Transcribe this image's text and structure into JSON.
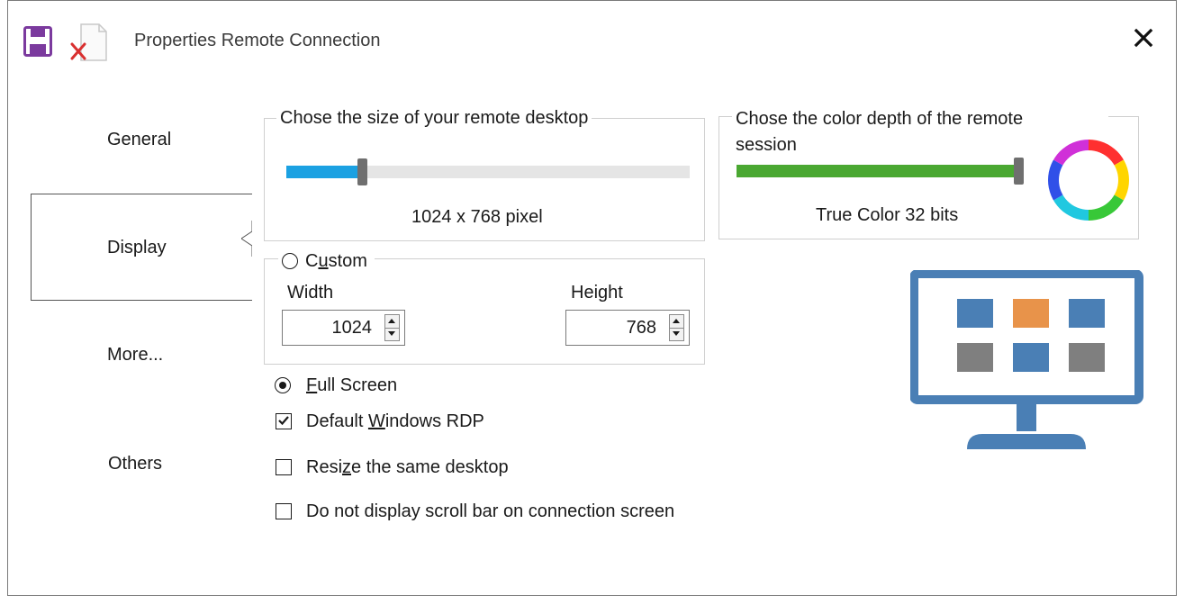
{
  "window": {
    "title": "Properties Remote Connection"
  },
  "toolbar": {
    "save_icon": "floppy-disk-icon",
    "discard_icon": "document-close-icon",
    "close_icon": "close-x-icon"
  },
  "nav": {
    "items": [
      {
        "label": "General",
        "selected": false
      },
      {
        "label": "Display",
        "selected": true
      },
      {
        "label": "More...",
        "selected": false
      },
      {
        "label": "Others",
        "selected": false
      }
    ]
  },
  "size_group": {
    "legend": "Chose the size of your remote desktop",
    "slider_fraction": 0.18,
    "value_label": "1024 x 768 pixel",
    "fill_color": "#1ba1e2"
  },
  "color_group": {
    "legend_line1": "Chose the color depth of the remote",
    "legend_line2": "session",
    "slider_fraction": 1.0,
    "value_label": "True Color 32 bits",
    "fill_color": "#4aa832",
    "icon": "color-wheel-icon"
  },
  "custom_group": {
    "radio_label_pre": "C",
    "radio_label_u": "u",
    "radio_label_post": "stom",
    "width_label": "Width",
    "width_value": "1024",
    "height_label": "Height",
    "height_value": "768"
  },
  "options": {
    "full_screen_u": "F",
    "full_screen_rest": "ull Screen",
    "default_rdp_pre": "Default ",
    "default_rdp_u": "W",
    "default_rdp_post": "indows RDP",
    "resize_pre": "Resi",
    "resize_u": "z",
    "resize_post": "e the same desktop",
    "no_scrollbar": "Do not display scroll bar on connection screen"
  },
  "monitor": {
    "icon": "monitor-icon",
    "frame_color": "#4a7fb5",
    "tiles": [
      "#4a7fb5",
      "#e8934a",
      "#4a7fb5",
      "#7f7f7f",
      "#4a7fb5",
      "#7f7f7f"
    ]
  }
}
